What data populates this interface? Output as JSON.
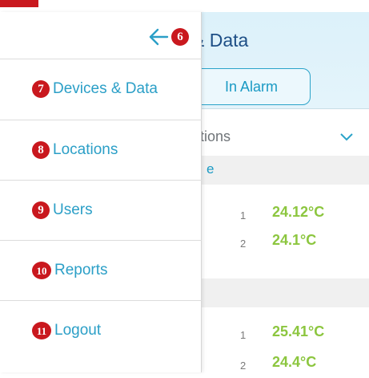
{
  "header": {
    "title_fragment": "& Data",
    "alarm_button_label": "In Alarm"
  },
  "filter": {
    "label_fragment": "ations",
    "icon": "chevron-down-icon"
  },
  "sections": [
    {
      "band_text": "e"
    },
    {
      "band_text": ""
    }
  ],
  "readings": [
    {
      "index": "1",
      "value": "24.12°C"
    },
    {
      "index": "2",
      "value": "24.1°C"
    },
    {
      "index": "1",
      "value": "25.41°C"
    },
    {
      "index": "2",
      "value": "24.4°C"
    }
  ],
  "drawer": {
    "back_icon": "back-arrow-icon",
    "back_marker": "6",
    "items": [
      {
        "marker": "7",
        "label": "Devices & Data"
      },
      {
        "marker": "8",
        "label": "Locations"
      },
      {
        "marker": "9",
        "label": "Users"
      },
      {
        "marker": "10",
        "label": "Reports"
      },
      {
        "marker": "11",
        "label": "Logout"
      }
    ]
  },
  "colors": {
    "accent": "#2b9fc7",
    "marker_red": "#c9181e",
    "reading_green": "#8cc63f",
    "title_blue": "#1e4f86",
    "header_bg": "#dcf1fa"
  }
}
